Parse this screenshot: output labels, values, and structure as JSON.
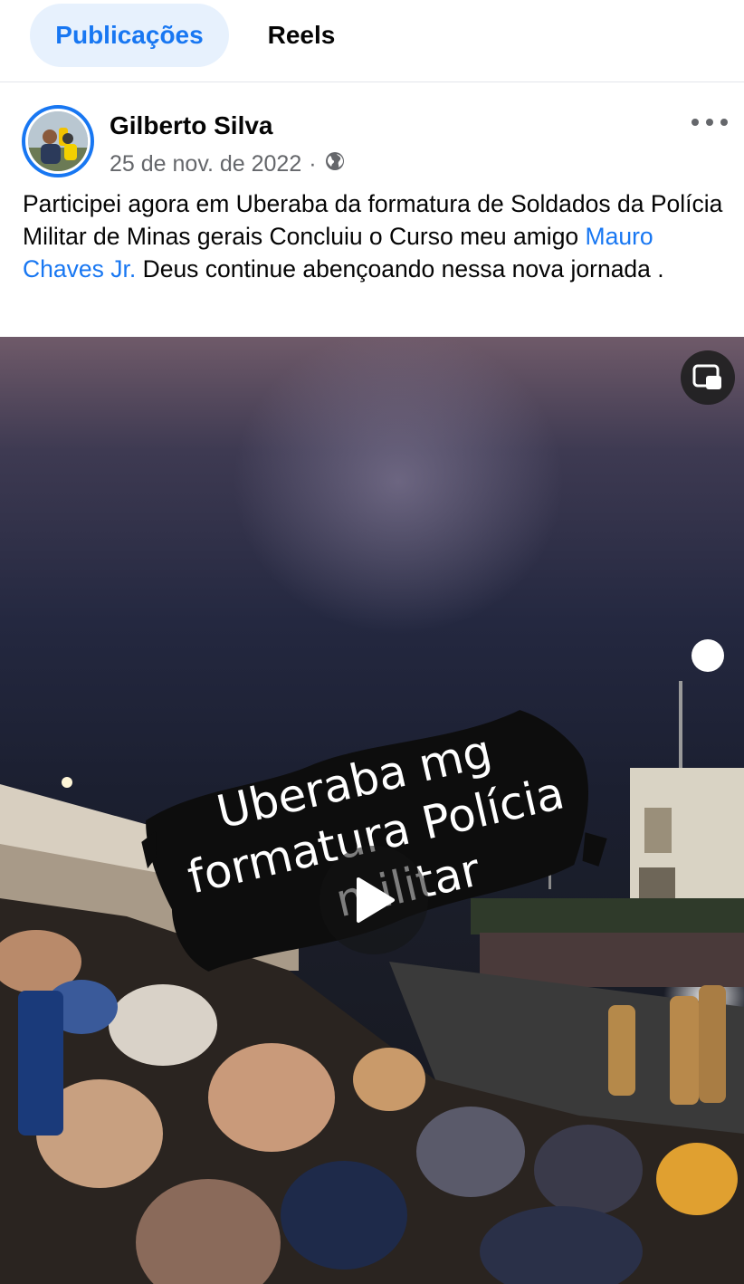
{
  "tabs": [
    {
      "label": "Publicações",
      "active": true
    },
    {
      "label": "Reels",
      "active": false
    }
  ],
  "post": {
    "author": "Gilberto Silva",
    "date": "25 de nov. de 2022",
    "separator": "·",
    "privacy_icon": "globe-icon",
    "more_icon": "more-options-icon",
    "text_before_mention": "Participei agora em Uberaba da formatura de Soldados da Polícia Militar de Minas gerais Concluiu o Curso meu amigo ",
    "mention": "Mauro Chaves Jr.",
    "text_after_mention": "  Deus continue abençoando nessa nova jornada ."
  },
  "video": {
    "overlay_line1": "Uberaba mg",
    "overlay_line2": "formatura Polícia",
    "overlay_line3": "militar",
    "pip_icon": "picture-in-picture-icon",
    "play_icon": "play-icon"
  },
  "colors": {
    "accent": "#1877f2",
    "active_tab_bg": "#e7f1fd",
    "secondary_text": "#65676b"
  }
}
